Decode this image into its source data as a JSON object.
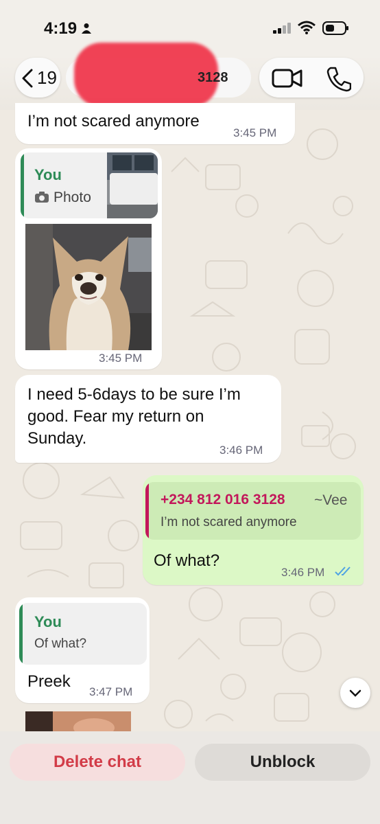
{
  "status_bar": {
    "time": "4:19"
  },
  "header": {
    "back_count": "19",
    "contact_name_visible": "3128"
  },
  "messages": [
    {
      "text": "I’m not scared anymore",
      "time": "3:45 PM"
    },
    {
      "reply_author": "You",
      "reply_text": "Photo",
      "time": "3:45 PM"
    },
    {
      "text": "I need 5-6days to be sure I’m good. Fear my return on Sunday.",
      "lines": [
        "I need 5-6days to be sure I’m",
        "good. Fear my return on",
        "Sunday."
      ],
      "time": "3:46 PM"
    },
    {
      "reply_author": "+234 812 016 3128",
      "reply_alias": "~Vee",
      "reply_text": "I’m not scared anymore",
      "text": "Of what?",
      "time": "3:46 PM"
    },
    {
      "reply_author": "You",
      "reply_text": "Of what?",
      "text": "Preek",
      "time": "3:47 PM"
    }
  ],
  "actions": {
    "delete_label": "Delete chat",
    "unblock_label": "Unblock"
  },
  "colors": {
    "accent_green": "#2e8b57",
    "reply_pink": "#c2185b",
    "delete_red": "#d23c48",
    "read_tick": "#4fa3e3"
  }
}
